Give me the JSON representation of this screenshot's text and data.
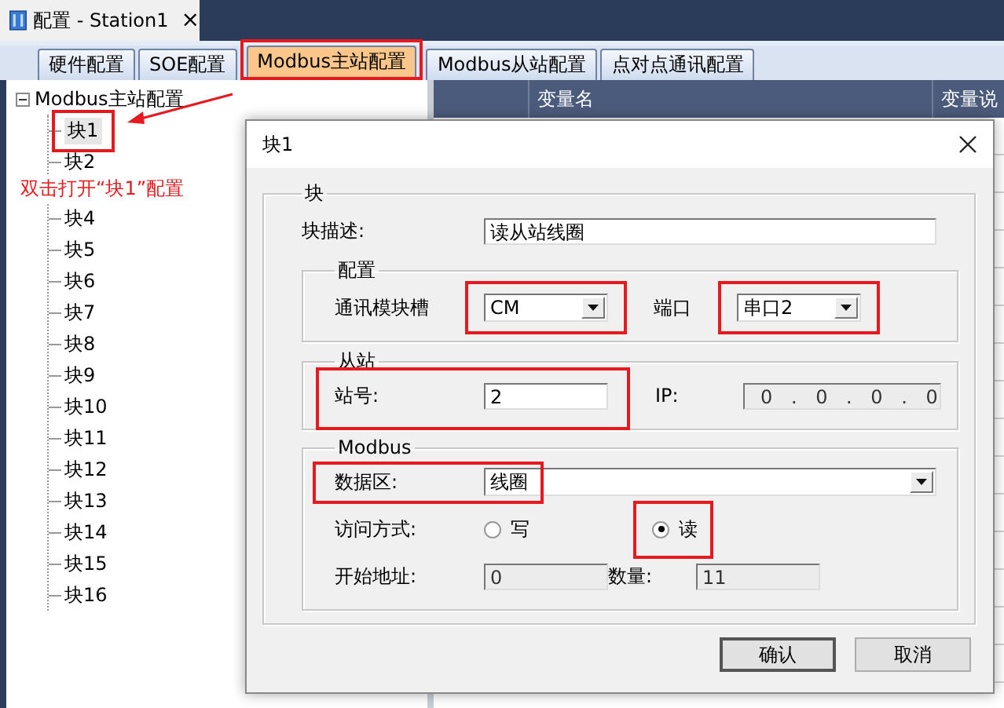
{
  "doc_tab": {
    "title": "配置 - Station1",
    "close": "×"
  },
  "tabs": [
    {
      "label": "硬件配置",
      "selected": false,
      "highlighted": false
    },
    {
      "label": "SOE配置",
      "selected": false,
      "highlighted": false
    },
    {
      "label": "Modbus主站配置",
      "selected": true,
      "highlighted": true
    },
    {
      "label": "Modbus从站配置",
      "selected": false,
      "highlighted": false
    },
    {
      "label": "点对点通讯配置",
      "selected": false,
      "highlighted": false
    }
  ],
  "tree": {
    "label": "Modbus主站配置",
    "expanded": true,
    "children": [
      {
        "label": "块1",
        "selected": true,
        "highlighted": true
      },
      {
        "label": "块2",
        "selected": false,
        "highlighted": false
      },
      {
        "kind": "note",
        "text": "双击打开“块1”配置"
      },
      {
        "label": "块4",
        "selected": false,
        "highlighted": false
      },
      {
        "label": "块5",
        "selected": false,
        "highlighted": false
      },
      {
        "label": "块6",
        "selected": false,
        "highlighted": false
      },
      {
        "label": "块7",
        "selected": false,
        "highlighted": false
      },
      {
        "label": "块8",
        "selected": false,
        "highlighted": false
      },
      {
        "label": "块9",
        "selected": false,
        "highlighted": false
      },
      {
        "label": "块10",
        "selected": false,
        "highlighted": false
      },
      {
        "label": "块11",
        "selected": false,
        "highlighted": false
      },
      {
        "label": "块12",
        "selected": false,
        "highlighted": false
      },
      {
        "label": "块13",
        "selected": false,
        "highlighted": false
      },
      {
        "label": "块14",
        "selected": false,
        "highlighted": false
      },
      {
        "label": "块15",
        "selected": false,
        "highlighted": false
      },
      {
        "label": "块16",
        "selected": false,
        "highlighted": false
      }
    ]
  },
  "grid": {
    "columns": [
      "变量名",
      "变量说"
    ]
  },
  "dialog": {
    "title": "块1",
    "group": "块",
    "description": {
      "label": "块描述:",
      "value": "读从站线圈"
    },
    "config": {
      "title": "配置",
      "slot": {
        "label": "通讯模块槽",
        "value": "CM",
        "highlighted": true
      },
      "port": {
        "label": "端口",
        "value": "串口2",
        "highlighted": true
      }
    },
    "slave": {
      "title": "从站",
      "station": {
        "label": "站号:",
        "value": "2",
        "highlighted": true
      },
      "ip": {
        "label": "IP:",
        "value": "0 . 0 . 0 . 0",
        "disabled": true
      }
    },
    "modbus": {
      "title": "Modbus",
      "area": {
        "label": "数据区:",
        "value": "线圈",
        "highlighted": true
      },
      "access": {
        "label": "访问方式:",
        "options": [
          {
            "label": "写",
            "selected": false,
            "highlighted": false
          },
          {
            "label": "读",
            "selected": true,
            "highlighted": true
          }
        ]
      },
      "start": {
        "label": "开始地址:",
        "value": "0",
        "disabled": true
      },
      "count": {
        "label": "数量:",
        "value": "11",
        "disabled": true
      }
    },
    "buttons": [
      {
        "label": "确认",
        "default": true
      },
      {
        "label": "取消",
        "default": false
      }
    ]
  }
}
